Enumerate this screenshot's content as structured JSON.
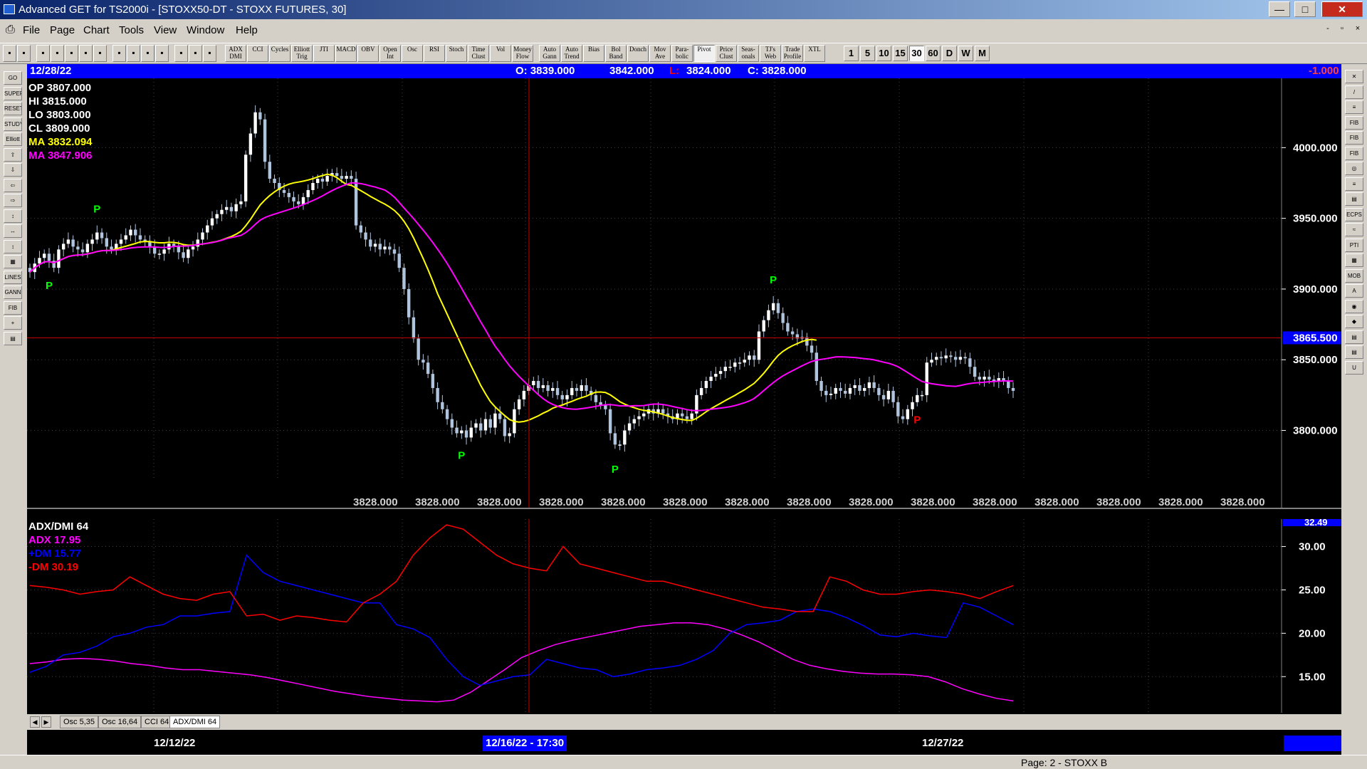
{
  "window": {
    "title": "Advanced GET for TS2000i - [STOXX50-DT - STOXX FUTURES, 30]",
    "min_glyph": "—",
    "max_glyph": "□",
    "close_glyph": "✕",
    "mdi_min": "-",
    "mdi_restore": "▫",
    "mdi_close": "×"
  },
  "menu": [
    "File",
    "Page",
    "Chart",
    "Tools",
    "View",
    "Window",
    "Help"
  ],
  "toolbar": {
    "study_buttons": [
      "ADX DMI",
      "CCI",
      "Cycles",
      "Elliott Trig",
      "JTI",
      "MACD",
      "OBV",
      "Open Int",
      "Osc",
      "RSI",
      "Stoch",
      "Time Clust",
      "Vol",
      "Money Flow",
      "Auto Gann",
      "Auto Trend",
      "Bias",
      "Bol Band",
      "Donch",
      "Mov Ave",
      "Para-bolic",
      "Pivot",
      "Price Clust",
      "Seas-onals",
      "TJ's Web",
      "Trade Profile",
      "XTL"
    ],
    "timeframes": [
      "1",
      "5",
      "10",
      "15",
      "30",
      "60",
      "D",
      "W",
      "M"
    ],
    "active_timeframe": "30"
  },
  "left_tools": [
    "GO",
    "SUPER",
    "RESET",
    "STUDY",
    "Elliott",
    "⇧",
    "⇩",
    "⇦",
    "⇨",
    "↕",
    "↔",
    "↕",
    "▦",
    "LINES",
    "GANN",
    "FIB",
    "+",
    "▤"
  ],
  "right_tools": [
    "✕",
    "/",
    "≡",
    "FIB RET",
    "FIB EXT",
    "FIB TIME",
    "◎",
    "≡",
    "▤",
    "ECPS",
    "≈",
    "PTI",
    "▦",
    "MOB",
    "A",
    "◉",
    "◆",
    "▤",
    "▤",
    "U"
  ],
  "info_bar": {
    "date": "12/28/22",
    "open": "O: 3839.000",
    "high": "3842.000",
    "low_label": "L:",
    "low": "3824.000",
    "close": "C: 3828.000",
    "change": "-1.000"
  },
  "price_legend": [
    {
      "label": "OP  3807.000",
      "color": "#ffffff"
    },
    {
      "label": "HI   3815.000",
      "color": "#ffffff"
    },
    {
      "label": "LO  3803.000",
      "color": "#ffffff"
    },
    {
      "label": "CL  3809.000",
      "color": "#ffffff"
    },
    {
      "label": "MA  3832.094",
      "color": "#ffff00"
    },
    {
      "label": "MA  3847.906",
      "color": "#ff00ff"
    }
  ],
  "indicator_legend": [
    {
      "label": "ADX/DMI 64",
      "color": "#ffffff"
    },
    {
      "label": "ADX 17.95",
      "color": "#ff00ff"
    },
    {
      "label": "+DM 15.77",
      "color": "#0000ff"
    },
    {
      "label": "-DM  30.19",
      "color": "#ff0000"
    }
  ],
  "chart_data": [
    {
      "type": "candlestick",
      "title": "STOXX50-DT - STOXX FUTURES, 30",
      "y_ticks": [
        "4000.000",
        "3950.000",
        "3900.000",
        "3850.000",
        "3800.000"
      ],
      "ylim": [
        3763,
        4045
      ],
      "cursor_price": "3865.500",
      "bottom_readout": "3828.000",
      "x_labels": [
        "12/12/22",
        "12/16/22 - 17:30",
        "12/27/22"
      ],
      "closes": [
        3912,
        3918,
        3922,
        3925,
        3920,
        3915,
        3928,
        3932,
        3935,
        3930,
        3928,
        3926,
        3932,
        3935,
        3940,
        3936,
        3930,
        3928,
        3932,
        3935,
        3938,
        3942,
        3938,
        3935,
        3934,
        3930,
        3925,
        3925,
        3928,
        3932,
        3930,
        3926,
        3922,
        3928,
        3930,
        3935,
        3940,
        3945,
        3950,
        3953,
        3956,
        3958,
        3955,
        3960,
        3962,
        3995,
        4010,
        4025,
        4020,
        3990,
        3978,
        3975,
        3970,
        3968,
        3965,
        3962,
        3960,
        3965,
        3970,
        3975,
        3978,
        3976,
        3980,
        3982,
        3980,
        3978,
        3980,
        3978,
        3945,
        3940,
        3935,
        3930,
        3932,
        3928,
        3930,
        3928,
        3925,
        3915,
        3900,
        3880,
        3865,
        3850,
        3848,
        3840,
        3830,
        3820,
        3815,
        3808,
        3802,
        3798,
        3800,
        3795,
        3802,
        3805,
        3800,
        3808,
        3802,
        3812,
        3808,
        3796,
        3798,
        3815,
        3822,
        3828,
        3832,
        3835,
        3830,
        3832,
        3828,
        3830,
        3825,
        3822,
        3825,
        3830,
        3828,
        3832,
        3828,
        3825,
        3820,
        3818,
        3815,
        3798,
        3790,
        3790,
        3800,
        3805,
        3808,
        3810,
        3812,
        3815,
        3812,
        3815,
        3812,
        3810,
        3808,
        3812,
        3810,
        3808,
        3812,
        3825,
        3830,
        3835,
        3838,
        3840,
        3842,
        3845,
        3845,
        3848,
        3848,
        3850,
        3853,
        3850,
        3870,
        3878,
        3885,
        3890,
        3883,
        3876,
        3870,
        3868,
        3865,
        3866,
        3860,
        3855,
        3835,
        3828,
        3825,
        3826,
        3830,
        3828,
        3826,
        3830,
        3832,
        3828,
        3830,
        3834,
        3830,
        3825,
        3822,
        3828,
        3820,
        3810,
        3808,
        3815,
        3820,
        3825,
        3825,
        3848,
        3850,
        3852,
        3851,
        3853,
        3852,
        3850,
        3852,
        3851,
        3845,
        3838,
        3836,
        3838,
        3836,
        3835,
        3837,
        3835,
        3830,
        3828
      ],
      "series": [
        {
          "name": "MA 3832.094",
          "color": "#ffff00"
        },
        {
          "name": "MA 3847.906",
          "color": "#ff00ff"
        }
      ],
      "pivots": [
        {
          "label": "P",
          "color": "#00ff00",
          "index": 4,
          "pos": "below"
        },
        {
          "label": "P",
          "color": "#00ff00",
          "index": 14,
          "pos": "above"
        },
        {
          "label": "P",
          "color": "#00ff00",
          "index": 90,
          "pos": "below"
        },
        {
          "label": "P",
          "color": "#00ff00",
          "index": 122,
          "pos": "below"
        },
        {
          "label": "P",
          "color": "#00ff00",
          "index": 155,
          "pos": "above"
        },
        {
          "label": "P",
          "color": "#ff0000",
          "index": 185,
          "pos": "below"
        }
      ]
    },
    {
      "type": "line",
      "title": "ADX/DMI 64",
      "y_ticks": [
        "30.00",
        "25.00",
        "20.00",
        "15.00"
      ],
      "ylim": [
        11,
        33
      ],
      "current_badge": "32.49",
      "series": [
        {
          "name": "ADX 17.95",
          "color": "#ff00ff",
          "values": [
            16.5,
            16.7,
            17.0,
            17.1,
            17.0,
            16.8,
            16.5,
            16.3,
            16.0,
            15.8,
            15.8,
            15.6,
            15.4,
            15.2,
            14.9,
            14.5,
            14.1,
            13.7,
            13.3,
            13.0,
            12.7,
            12.5,
            12.3,
            12.2,
            12.1,
            12.3,
            13.2,
            14.5,
            15.8,
            17.2,
            18.0,
            18.7,
            19.2,
            19.6,
            20.0,
            20.4,
            20.8,
            21.0,
            21.2,
            21.2,
            21.0,
            20.5,
            19.8,
            19.0,
            18.0,
            17.0,
            16.3,
            15.9,
            15.6,
            15.4,
            15.3,
            15.3,
            15.2,
            15.0,
            14.4,
            13.6,
            13.0,
            12.5,
            12.2
          ]
        },
        {
          "name": "+DM 15.77",
          "color": "#0000ff",
          "values": [
            15.5,
            16.2,
            17.5,
            17.8,
            18.5,
            19.6,
            20.0,
            20.7,
            21.0,
            22.0,
            22.0,
            22.3,
            22.5,
            29.0,
            27.0,
            26.0,
            25.5,
            25.0,
            24.5,
            24.0,
            23.5,
            23.5,
            21.0,
            20.5,
            19.5,
            17.0,
            15.0,
            14.0,
            14.5,
            15.0,
            15.2,
            17.0,
            16.5,
            16.0,
            15.8,
            15.0,
            15.3,
            15.8,
            16.0,
            16.3,
            17.0,
            18.0,
            20.0,
            21.0,
            21.2,
            21.5,
            22.5,
            22.8,
            22.5,
            21.8,
            20.9,
            19.8,
            19.6,
            20.0,
            19.7,
            19.5,
            23.5,
            23.0,
            22.0,
            21.0
          ]
        },
        {
          "name": "-DM 30.19",
          "color": "#ff0000",
          "values": [
            25.5,
            25.3,
            25.0,
            24.5,
            24.8,
            25.0,
            26.5,
            25.5,
            24.5,
            24.0,
            23.8,
            24.5,
            24.8,
            22.0,
            22.2,
            21.5,
            22.0,
            21.8,
            21.5,
            21.3,
            23.5,
            24.5,
            26.0,
            29.0,
            31.0,
            32.5,
            32.0,
            30.5,
            29.0,
            28.0,
            27.5,
            27.2,
            30.0,
            28.0,
            27.5,
            27.0,
            26.5,
            26.0,
            26.0,
            25.5,
            25.0,
            24.5,
            24.0,
            23.5,
            23.0,
            22.8,
            22.5,
            22.5,
            26.5,
            26.0,
            25.0,
            24.5,
            24.5,
            24.8,
            25.0,
            24.8,
            24.5,
            24.0,
            24.8,
            25.5
          ]
        }
      ]
    }
  ],
  "tabs": [
    "Osc 5,35",
    "Osc 16,64",
    "CCI 64",
    "ADX/DMI 64"
  ],
  "active_tab": "ADX/DMI 64",
  "tab_nav": [
    "◀",
    "▶"
  ],
  "status": "Page: 2 - STOXX B"
}
